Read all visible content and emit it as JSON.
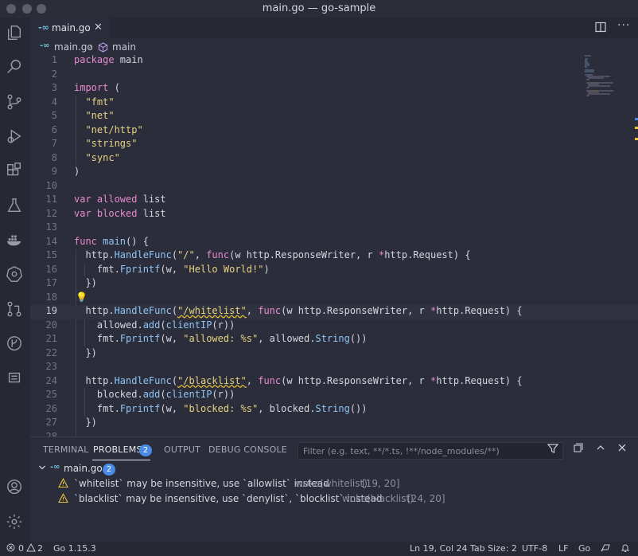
{
  "window": {
    "title": "main.go — go-sample"
  },
  "tabs": [
    {
      "icon": "go-file-icon",
      "label": "main.go",
      "close": "✕"
    }
  ],
  "breadcrumb": {
    "file": "main.go",
    "separator": "›",
    "symbol": "main"
  },
  "editor": {
    "current_line": 19,
    "lines": [
      {
        "n": "1"
      },
      {
        "n": "2"
      },
      {
        "n": "3"
      },
      {
        "n": "4"
      },
      {
        "n": "5"
      },
      {
        "n": "6"
      },
      {
        "n": "7"
      },
      {
        "n": "8"
      },
      {
        "n": "9"
      },
      {
        "n": "10"
      },
      {
        "n": "11"
      },
      {
        "n": "12"
      },
      {
        "n": "13"
      },
      {
        "n": "14"
      },
      {
        "n": "15"
      },
      {
        "n": "16"
      },
      {
        "n": "17"
      },
      {
        "n": "18"
      },
      {
        "n": "19"
      },
      {
        "n": "20"
      },
      {
        "n": "21"
      },
      {
        "n": "22"
      },
      {
        "n": "23"
      },
      {
        "n": "24"
      },
      {
        "n": "25"
      },
      {
        "n": "26"
      },
      {
        "n": "27"
      },
      {
        "n": "28"
      }
    ],
    "code": {
      "l1_kw": "package",
      "l1_rest": " main",
      "l3_kw": "import",
      "l3_rest": " (",
      "l4": "\"fmt\"",
      "l5": "\"net\"",
      "l6": "\"net/http\"",
      "l7": "\"strings\"",
      "l8": "\"sync\"",
      "l9": ")",
      "l11_kw": "var",
      "l11_id": " allowed",
      "l11_rest": " list",
      "l12_kw": "var",
      "l12_id": " blocked",
      "l12_rest": " list",
      "l14_kw": "func",
      "l14_fn": " main",
      "l14_rest": "() {",
      "l15_a": "http.",
      "l15_fn": "HandleFunc",
      "l15_b": "(",
      "l15_str": "\"/\"",
      "l15_c": ", ",
      "l15_kw": "func",
      "l15_d": "(w http.ResponseWriter, r ",
      "l15_star": "*",
      "l15_e": "http.Request) {",
      "l16_a": "fmt.",
      "l16_fn": "Fprintf",
      "l16_b": "(w, ",
      "l16_str": "\"Hello World!\"",
      "l16_c": ")",
      "l17": "})",
      "l19_a": "http.",
      "l19_fn": "HandleFunc",
      "l19_b": "(",
      "l19_str": "\"/whitelist\"",
      "l19_c": ", ",
      "l19_kw": "func",
      "l19_d": "(w http.ResponseWriter, r ",
      "l19_star": "*",
      "l19_e": "http.Request) {",
      "l20_a": "allowed.",
      "l20_fn": "add",
      "l20_b": "(",
      "l20_fn2": "clientIP",
      "l20_c": "(r))",
      "l21_a": "fmt.",
      "l21_fn": "Fprintf",
      "l21_b": "(w, ",
      "l21_str": "\"allowed: %s\"",
      "l21_c": ", allowed.",
      "l21_fn2": "String",
      "l21_d": "())",
      "l22": "})",
      "l24_a": "http.",
      "l24_fn": "HandleFunc",
      "l24_b": "(",
      "l24_str": "\"/blacklist\"",
      "l24_c": ", ",
      "l24_kw": "func",
      "l24_d": "(w http.ResponseWriter, r ",
      "l24_star": "*",
      "l24_e": "http.Request) {",
      "l25_a": "blocked.",
      "l25_fn": "add",
      "l25_b": "(",
      "l25_fn2": "clientIP",
      "l25_c": "(r))",
      "l26_a": "fmt.",
      "l26_fn": "Fprintf",
      "l26_b": "(w, ",
      "l26_str": "\"blocked: %s\"",
      "l26_c": ", blocked.",
      "l26_fn2": "String",
      "l26_d": "())",
      "l27": "})"
    }
  },
  "panel": {
    "tabs": {
      "terminal": "TERMINAL",
      "problems": "PROBLEMS",
      "output": "OUTPUT",
      "debug": "DEBUG CONSOLE"
    },
    "problems_count": "2",
    "filter_placeholder": "Filter (e.g. text, **/*.ts, !**/node_modules/**)",
    "file": {
      "name": "main.go",
      "count": "2"
    },
    "problems": [
      {
        "message": "`whitelist` may be insensitive, use `allowlist` instead",
        "source": "woke(whitelist)",
        "position": "[19, 20]"
      },
      {
        "message": "`blacklist` may be insensitive, use `denylist`, `blocklist` instead",
        "source": "woke(blacklist)",
        "position": "[24, 20]"
      }
    ]
  },
  "statusbar": {
    "errors": "0",
    "warnings": "2",
    "go_version": "Go 1.15.3",
    "cursor": "Ln 19, Col 24",
    "tab_size": "Tab Size: 2",
    "encoding": "UTF-8",
    "eol": "LF",
    "language": "Go"
  },
  "colors": {
    "background": "#2b2d3a",
    "activity_bar": "#262834",
    "keyword": "#e88ad0",
    "string": "#e6d382",
    "function": "#8fc4f5",
    "accent_badge": "#4b8be6",
    "warning": "#e8c23a"
  }
}
